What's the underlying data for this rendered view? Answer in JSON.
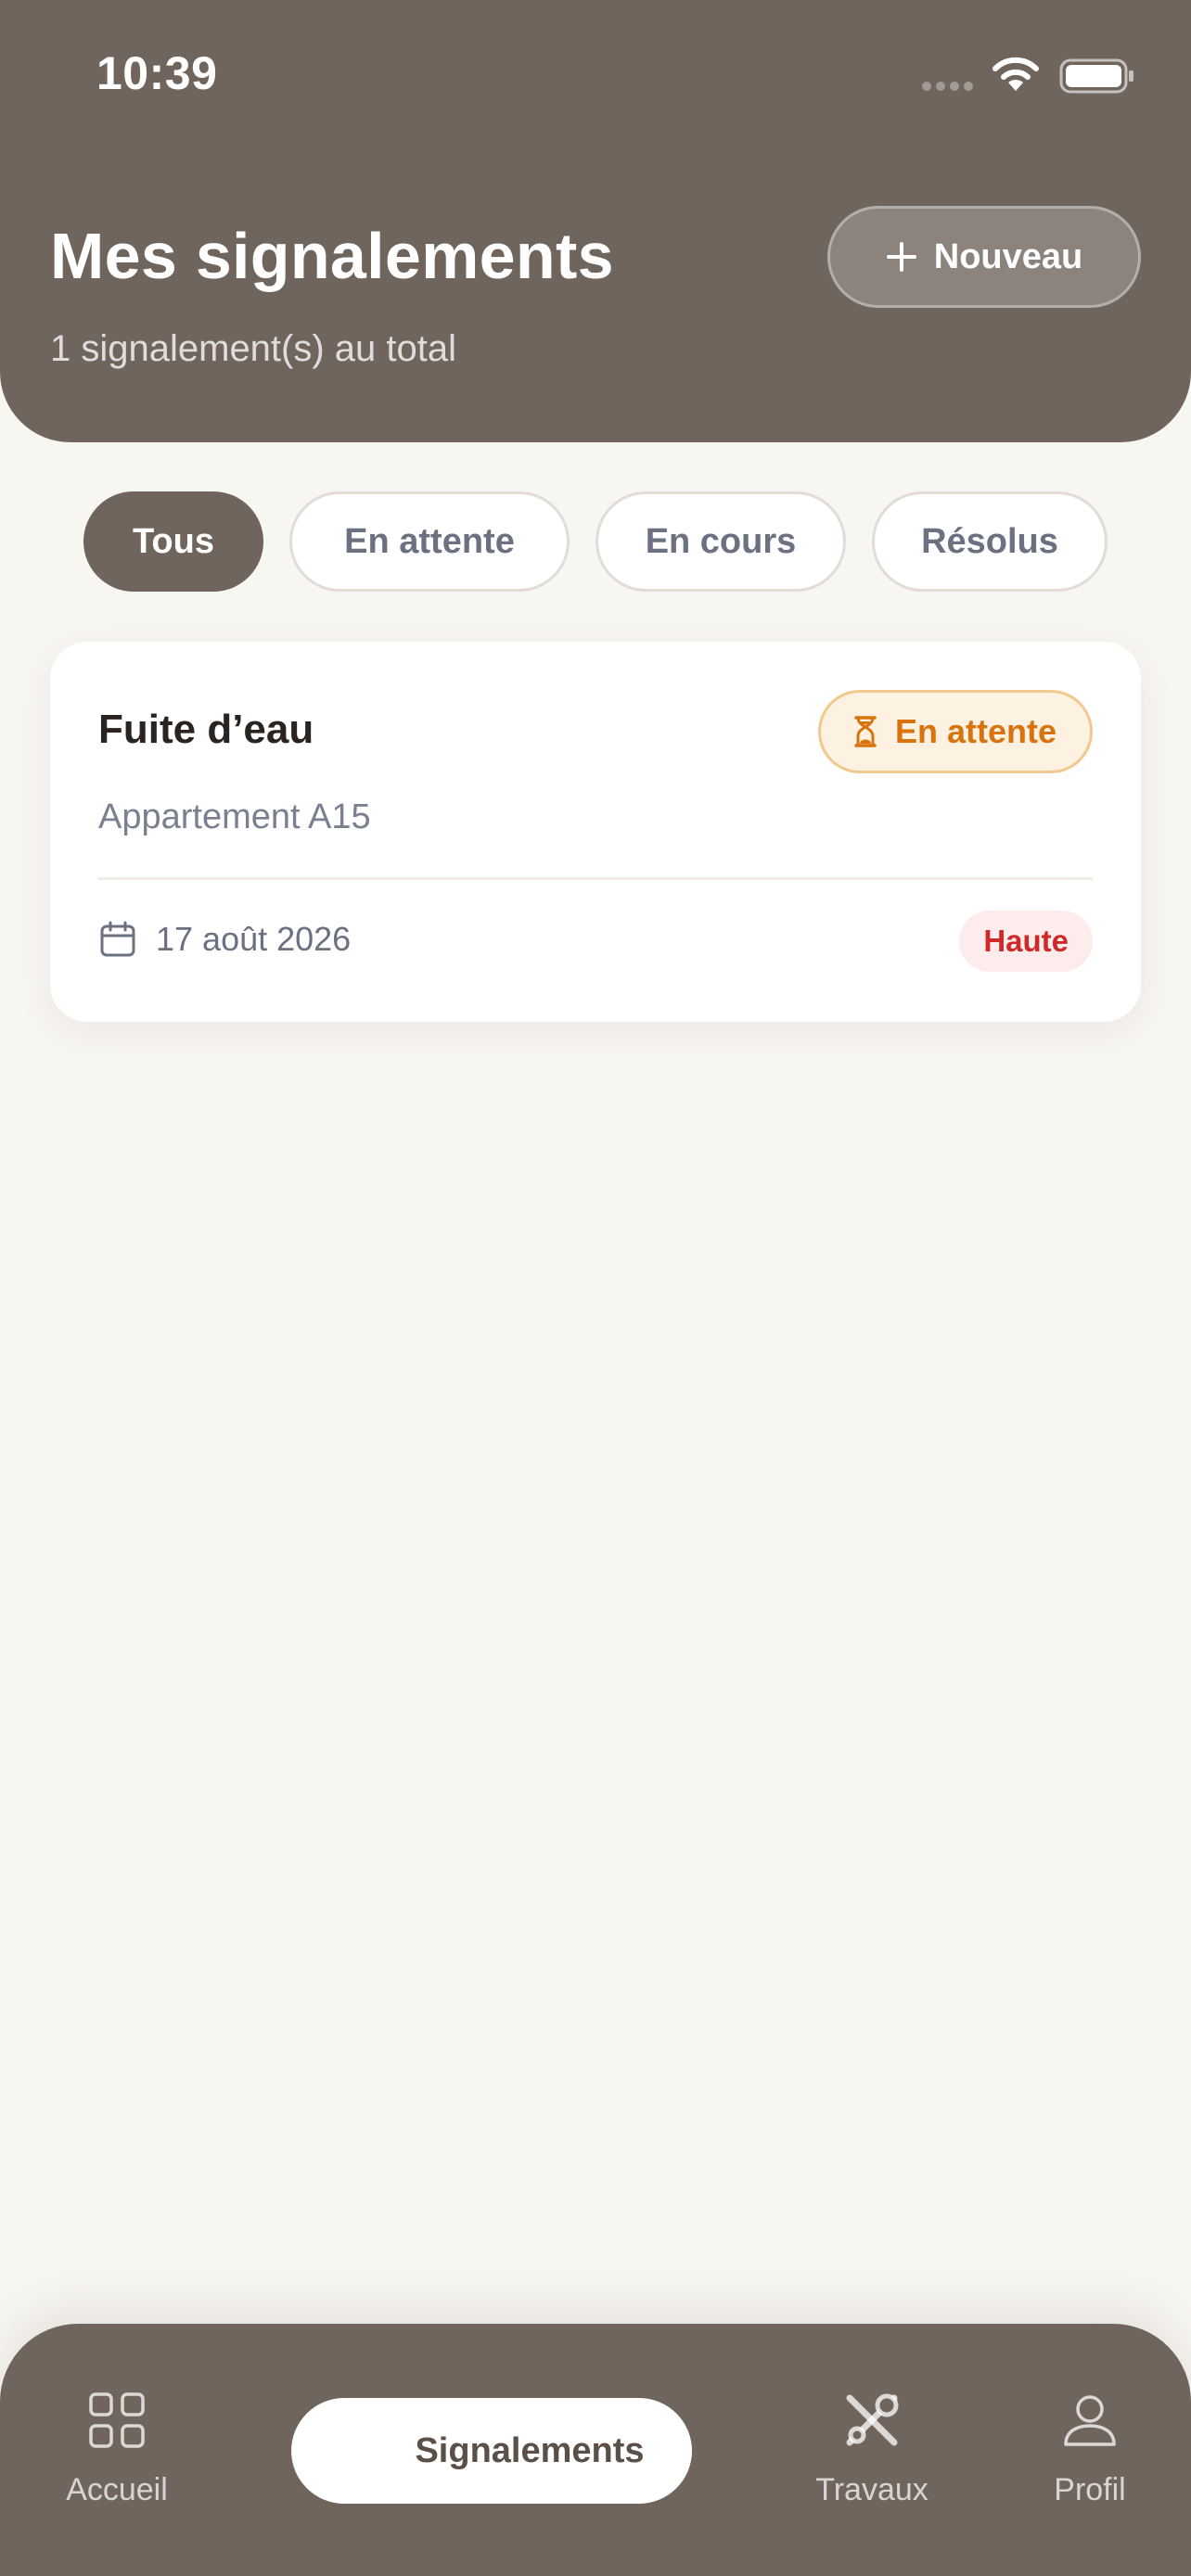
{
  "status_bar": {
    "time": "10:39",
    "wifi_icon": "wifi-icon",
    "battery_icon": "battery-icon"
  },
  "header": {
    "title": "Mes signalements",
    "subtitle": "1 signalement(s) au total",
    "new_button": {
      "icon": "plus-icon",
      "label": "Nouveau"
    }
  },
  "filters": [
    {
      "label": "Tous",
      "active": true
    },
    {
      "label": "En attente",
      "active": false
    },
    {
      "label": "En cours",
      "active": false
    },
    {
      "label": "Résolus",
      "active": false
    }
  ],
  "reports": [
    {
      "title": "Fuite d’eau",
      "status": {
        "label": "En attente",
        "icon": "hourglass-icon"
      },
      "location": "Appartement A15",
      "date_icon": "calendar-icon",
      "date": "17 août 2026",
      "priority": "Haute"
    }
  ],
  "bottom_nav": [
    {
      "label": "Accueil",
      "icon": "grid-icon",
      "active": false
    },
    {
      "label": "Signalements",
      "icon": "",
      "active": true
    },
    {
      "label": "Travaux",
      "icon": "tools-icon",
      "active": false
    },
    {
      "label": "Profil",
      "icon": "user-icon",
      "active": false
    }
  ],
  "colors": {
    "primary": "#6f655c",
    "background": "#f8f6f1",
    "pending": "#d9730d",
    "pending_bg": "#fdf1e1",
    "priority_high": "#cf2a2a",
    "priority_high_bg": "#fdecec",
    "muted_text": "#6b7180"
  }
}
